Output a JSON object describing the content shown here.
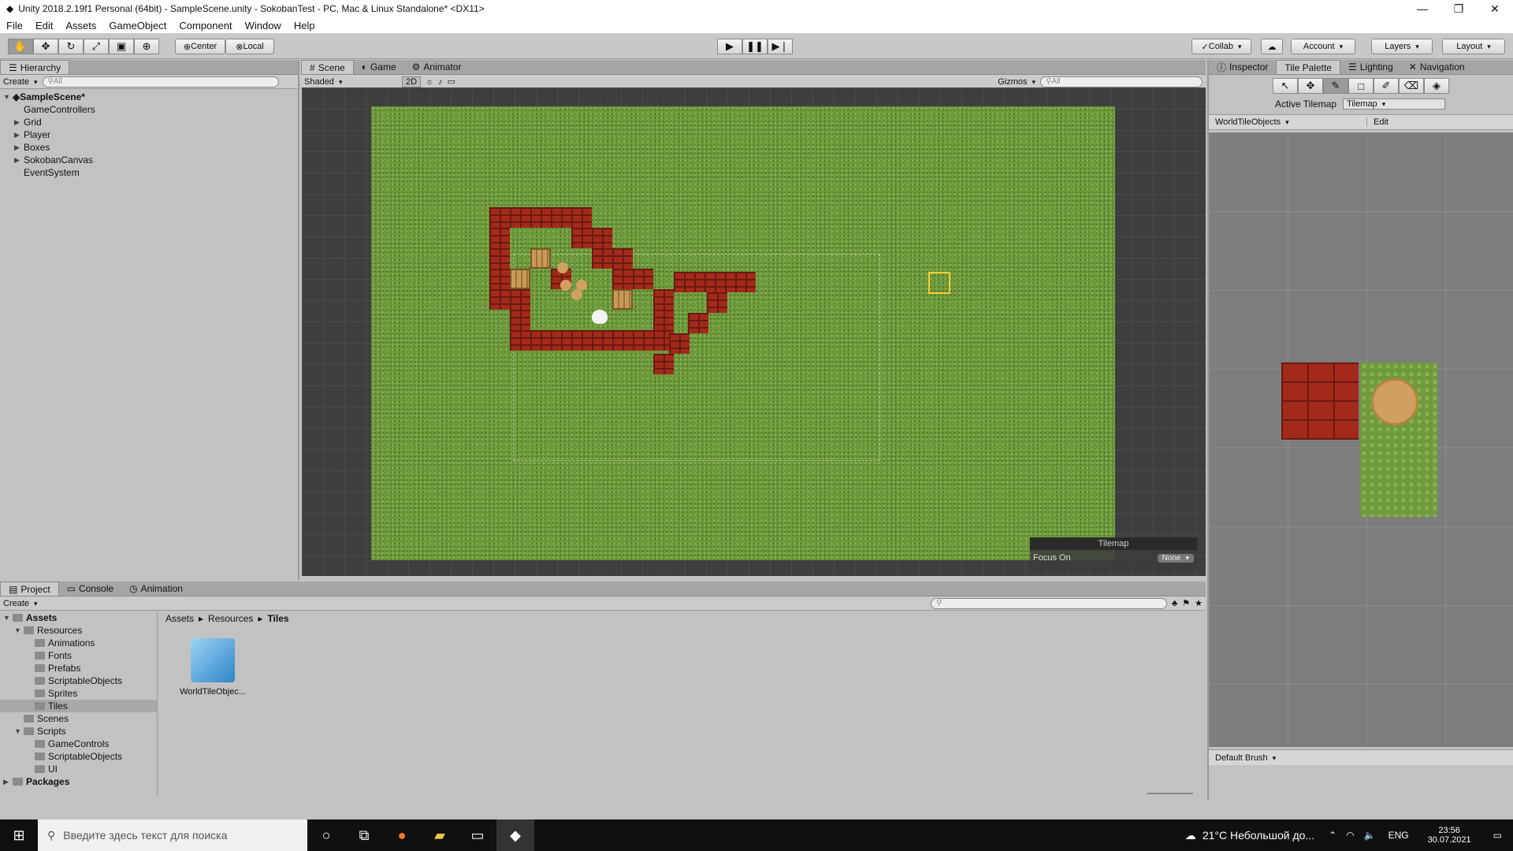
{
  "window": {
    "title": "Unity 2018.2.19f1 Personal (64bit) - SampleScene.unity - SokobanTest - PC, Mac & Linux Standalone* <DX11>",
    "minimize": "—",
    "maximize": "❐",
    "close": "✕"
  },
  "menu": [
    "File",
    "Edit",
    "Assets",
    "GameObject",
    "Component",
    "Window",
    "Help"
  ],
  "toolbar": {
    "pivot": "Center",
    "space": "Local",
    "collab": "Collab",
    "account": "Account",
    "layers": "Layers",
    "layout": "Layout"
  },
  "hierarchy": {
    "tab": "Hierarchy",
    "create": "Create",
    "search_placeholder": "All",
    "scene": "SampleScene*",
    "items": [
      "GameControllers",
      "Grid",
      "Player",
      "Boxes",
      "SokobanCanvas",
      "EventSystem"
    ]
  },
  "scene_tabs": {
    "scene": "Scene",
    "game": "Game",
    "animator": "Animator"
  },
  "scene_bar": {
    "shading": "Shaded",
    "mode2d": "2D",
    "gizmos": "Gizmos",
    "search_placeholder": "All"
  },
  "scene_overlay": {
    "title": "Tilemap",
    "focus_label": "Focus On",
    "focus_value": "None"
  },
  "right_tabs": {
    "inspector": "Inspector",
    "palette": "Tile Palette",
    "lighting": "Lighting",
    "navigation": "Navigation"
  },
  "palette": {
    "active_tilemap_label": "Active Tilemap",
    "active_tilemap_value": "Tilemap",
    "palette_name": "WorldTileObjects",
    "edit": "Edit",
    "brush": "Default Brush"
  },
  "bottom_tabs": {
    "project": "Project",
    "console": "Console",
    "animation": "Animation"
  },
  "project": {
    "create": "Create",
    "breadcrumb": [
      "Assets",
      "Resources",
      "Tiles"
    ],
    "tree": [
      {
        "label": "Assets",
        "depth": 0,
        "arrow": "▼",
        "bold": true
      },
      {
        "label": "Resources",
        "depth": 1,
        "arrow": "▼"
      },
      {
        "label": "Animations",
        "depth": 2,
        "arrow": ""
      },
      {
        "label": "Fonts",
        "depth": 2,
        "arrow": ""
      },
      {
        "label": "Prefabs",
        "depth": 2,
        "arrow": ""
      },
      {
        "label": "ScriptableObjects",
        "depth": 2,
        "arrow": ""
      },
      {
        "label": "Sprites",
        "depth": 2,
        "arrow": ""
      },
      {
        "label": "Tiles",
        "depth": 2,
        "arrow": "",
        "selected": true
      },
      {
        "label": "Scenes",
        "depth": 1,
        "arrow": ""
      },
      {
        "label": "Scripts",
        "depth": 1,
        "arrow": "▼"
      },
      {
        "label": "GameControls",
        "depth": 2,
        "arrow": ""
      },
      {
        "label": "ScriptableObjects",
        "depth": 2,
        "arrow": ""
      },
      {
        "label": "UI",
        "depth": 2,
        "arrow": ""
      },
      {
        "label": "Packages",
        "depth": 0,
        "arrow": "▶",
        "bold": true
      }
    ],
    "asset": "WorldTileObjec..."
  },
  "taskbar": {
    "search_placeholder": "Введите здесь текст для поиска",
    "weather": "21°C  Небольшой до...",
    "lang": "ENG",
    "time": "23:56",
    "date": "30.07.2021"
  },
  "colors": {
    "accent_selection": "#ffcc33",
    "brick": "#a32a1a",
    "grass": "#6f9a3e"
  }
}
